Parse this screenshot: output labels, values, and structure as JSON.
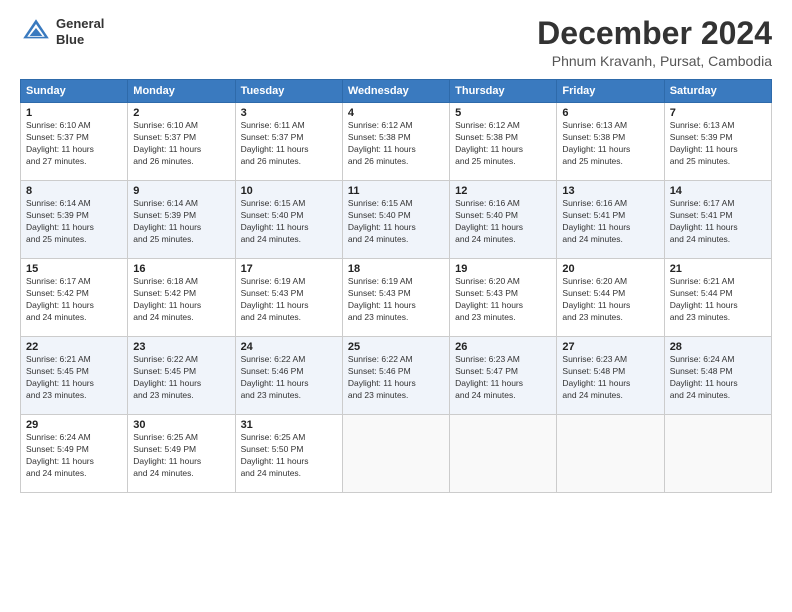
{
  "logo": {
    "line1": "General",
    "line2": "Blue"
  },
  "header": {
    "month_year": "December 2024",
    "location": "Phnum Kravanh, Pursat, Cambodia"
  },
  "weekdays": [
    "Sunday",
    "Monday",
    "Tuesday",
    "Wednesday",
    "Thursday",
    "Friday",
    "Saturday"
  ],
  "weeks": [
    [
      {
        "day": "1",
        "sunrise": "6:10 AM",
        "sunset": "5:37 PM",
        "daylight": "11 hours and 27 minutes."
      },
      {
        "day": "2",
        "sunrise": "6:10 AM",
        "sunset": "5:37 PM",
        "daylight": "11 hours and 26 minutes."
      },
      {
        "day": "3",
        "sunrise": "6:11 AM",
        "sunset": "5:37 PM",
        "daylight": "11 hours and 26 minutes."
      },
      {
        "day": "4",
        "sunrise": "6:12 AM",
        "sunset": "5:38 PM",
        "daylight": "11 hours and 26 minutes."
      },
      {
        "day": "5",
        "sunrise": "6:12 AM",
        "sunset": "5:38 PM",
        "daylight": "11 hours and 25 minutes."
      },
      {
        "day": "6",
        "sunrise": "6:13 AM",
        "sunset": "5:38 PM",
        "daylight": "11 hours and 25 minutes."
      },
      {
        "day": "7",
        "sunrise": "6:13 AM",
        "sunset": "5:39 PM",
        "daylight": "11 hours and 25 minutes."
      }
    ],
    [
      {
        "day": "8",
        "sunrise": "6:14 AM",
        "sunset": "5:39 PM",
        "daylight": "11 hours and 25 minutes."
      },
      {
        "day": "9",
        "sunrise": "6:14 AM",
        "sunset": "5:39 PM",
        "daylight": "11 hours and 25 minutes."
      },
      {
        "day": "10",
        "sunrise": "6:15 AM",
        "sunset": "5:40 PM",
        "daylight": "11 hours and 24 minutes."
      },
      {
        "day": "11",
        "sunrise": "6:15 AM",
        "sunset": "5:40 PM",
        "daylight": "11 hours and 24 minutes."
      },
      {
        "day": "12",
        "sunrise": "6:16 AM",
        "sunset": "5:40 PM",
        "daylight": "11 hours and 24 minutes."
      },
      {
        "day": "13",
        "sunrise": "6:16 AM",
        "sunset": "5:41 PM",
        "daylight": "11 hours and 24 minutes."
      },
      {
        "day": "14",
        "sunrise": "6:17 AM",
        "sunset": "5:41 PM",
        "daylight": "11 hours and 24 minutes."
      }
    ],
    [
      {
        "day": "15",
        "sunrise": "6:17 AM",
        "sunset": "5:42 PM",
        "daylight": "11 hours and 24 minutes."
      },
      {
        "day": "16",
        "sunrise": "6:18 AM",
        "sunset": "5:42 PM",
        "daylight": "11 hours and 24 minutes."
      },
      {
        "day": "17",
        "sunrise": "6:19 AM",
        "sunset": "5:43 PM",
        "daylight": "11 hours and 24 minutes."
      },
      {
        "day": "18",
        "sunrise": "6:19 AM",
        "sunset": "5:43 PM",
        "daylight": "11 hours and 23 minutes."
      },
      {
        "day": "19",
        "sunrise": "6:20 AM",
        "sunset": "5:43 PM",
        "daylight": "11 hours and 23 minutes."
      },
      {
        "day": "20",
        "sunrise": "6:20 AM",
        "sunset": "5:44 PM",
        "daylight": "11 hours and 23 minutes."
      },
      {
        "day": "21",
        "sunrise": "6:21 AM",
        "sunset": "5:44 PM",
        "daylight": "11 hours and 23 minutes."
      }
    ],
    [
      {
        "day": "22",
        "sunrise": "6:21 AM",
        "sunset": "5:45 PM",
        "daylight": "11 hours and 23 minutes."
      },
      {
        "day": "23",
        "sunrise": "6:22 AM",
        "sunset": "5:45 PM",
        "daylight": "11 hours and 23 minutes."
      },
      {
        "day": "24",
        "sunrise": "6:22 AM",
        "sunset": "5:46 PM",
        "daylight": "11 hours and 23 minutes."
      },
      {
        "day": "25",
        "sunrise": "6:22 AM",
        "sunset": "5:46 PM",
        "daylight": "11 hours and 23 minutes."
      },
      {
        "day": "26",
        "sunrise": "6:23 AM",
        "sunset": "5:47 PM",
        "daylight": "11 hours and 24 minutes."
      },
      {
        "day": "27",
        "sunrise": "6:23 AM",
        "sunset": "5:48 PM",
        "daylight": "11 hours and 24 minutes."
      },
      {
        "day": "28",
        "sunrise": "6:24 AM",
        "sunset": "5:48 PM",
        "daylight": "11 hours and 24 minutes."
      }
    ],
    [
      {
        "day": "29",
        "sunrise": "6:24 AM",
        "sunset": "5:49 PM",
        "daylight": "11 hours and 24 minutes."
      },
      {
        "day": "30",
        "sunrise": "6:25 AM",
        "sunset": "5:49 PM",
        "daylight": "11 hours and 24 minutes."
      },
      {
        "day": "31",
        "sunrise": "6:25 AM",
        "sunset": "5:50 PM",
        "daylight": "11 hours and 24 minutes."
      },
      null,
      null,
      null,
      null
    ]
  ]
}
